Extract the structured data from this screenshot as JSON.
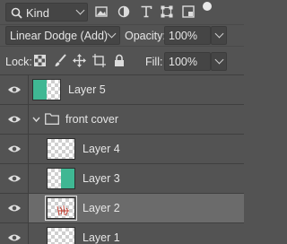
{
  "filter": {
    "kind_label": "Kind",
    "filter_icons": [
      "image-filter-icon",
      "adjustment-filter-icon",
      "type-filter-icon",
      "shape-filter-icon",
      "smart-object-filter-icon"
    ]
  },
  "blend": {
    "mode": "Linear Dodge (Add)",
    "opacity_label": "Opacity:",
    "opacity_value": "100%"
  },
  "lock": {
    "label": "Lock:",
    "fill_label": "Fill:",
    "fill_value": "100%"
  },
  "layers": [
    {
      "name": "Layer 5",
      "thumb": "teal-half"
    },
    {
      "name": "front cover",
      "type": "group"
    },
    {
      "name": "Layer 4",
      "thumb": "transparent"
    },
    {
      "name": "Layer 3",
      "thumb": "teal-half"
    },
    {
      "name": "Layer 2",
      "thumb": "sketch",
      "selected": true
    },
    {
      "name": "Layer 1",
      "thumb": "transparent"
    }
  ],
  "colors": {
    "panel_bg": "#535353",
    "selected_row": "#6b6b6b",
    "teal": "#3fb793",
    "sketch_red": "#c0392b"
  }
}
